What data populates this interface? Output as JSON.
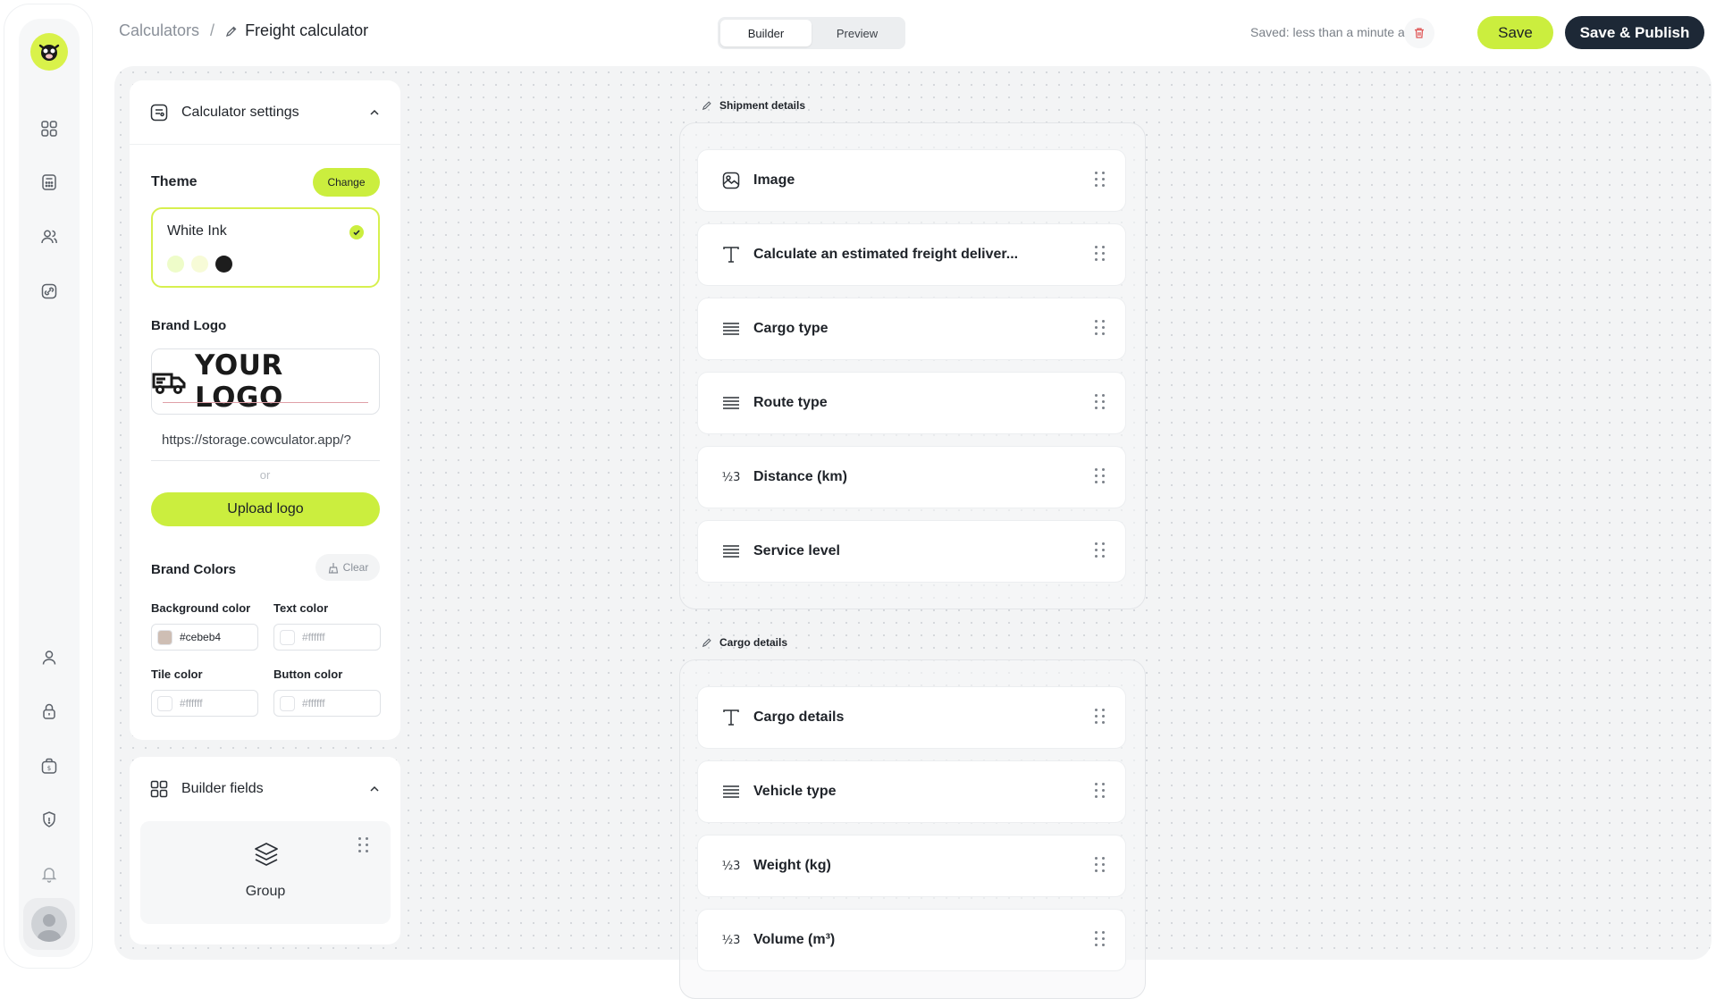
{
  "header": {
    "breadcrumb_root": "Calculators",
    "breadcrumb_sep": "/",
    "page_title": "Freight calculator",
    "modes": [
      "Builder",
      "Preview"
    ],
    "active_mode": "Builder",
    "saved_status": "Saved: less than a minute ago",
    "save_label": "Save",
    "publish_label": "Save & Publish"
  },
  "settings": {
    "title": "Calculator settings",
    "theme_label": "Theme",
    "change_label": "Change",
    "theme_name": "White Ink",
    "theme_swatches": [
      "#eefcc9",
      "#f7fbd7",
      "#1d1d1d"
    ],
    "brand_logo_label": "Brand Logo",
    "logo_text": "YOUR LOGO",
    "logo_url": "https://storage.cowculator.app/?",
    "or_label": "or",
    "upload_label": "Upload logo",
    "brand_colors_label": "Brand Colors",
    "clear_label": "Clear",
    "colors": {
      "background_label": "Background color",
      "background_value": "#cebeb4",
      "text_label": "Text color",
      "text_value": "#ffffff",
      "tile_label": "Tile color",
      "tile_value": "#ffffff",
      "button_label": "Button color",
      "button_value": "#ffffff"
    }
  },
  "builder_fields": {
    "title": "Builder fields",
    "group_label": "Group"
  },
  "sections": [
    {
      "title": "Shipment details",
      "fields": [
        {
          "label": "Image",
          "icon": "image-icon"
        },
        {
          "label": "Calculate an estimated freight deliver...",
          "icon": "text-icon"
        },
        {
          "label": "Cargo type",
          "icon": "list-icon"
        },
        {
          "label": "Route type",
          "icon": "list-icon"
        },
        {
          "label": "Distance (km)",
          "icon": "number-icon"
        },
        {
          "label": "Service level",
          "icon": "list-icon"
        }
      ]
    },
    {
      "title": "Cargo details",
      "fields": [
        {
          "label": "Cargo details",
          "icon": "text-icon"
        },
        {
          "label": "Vehicle type",
          "icon": "list-icon"
        },
        {
          "label": "Weight (kg)",
          "icon": "number-icon"
        },
        {
          "label": "Volume (m³)",
          "icon": "number-icon"
        }
      ]
    }
  ],
  "number_icon_glyph": "½3",
  "colors": {
    "accent": "#cbee3e",
    "dark": "#1d2836",
    "danger": "#e05a5a"
  }
}
